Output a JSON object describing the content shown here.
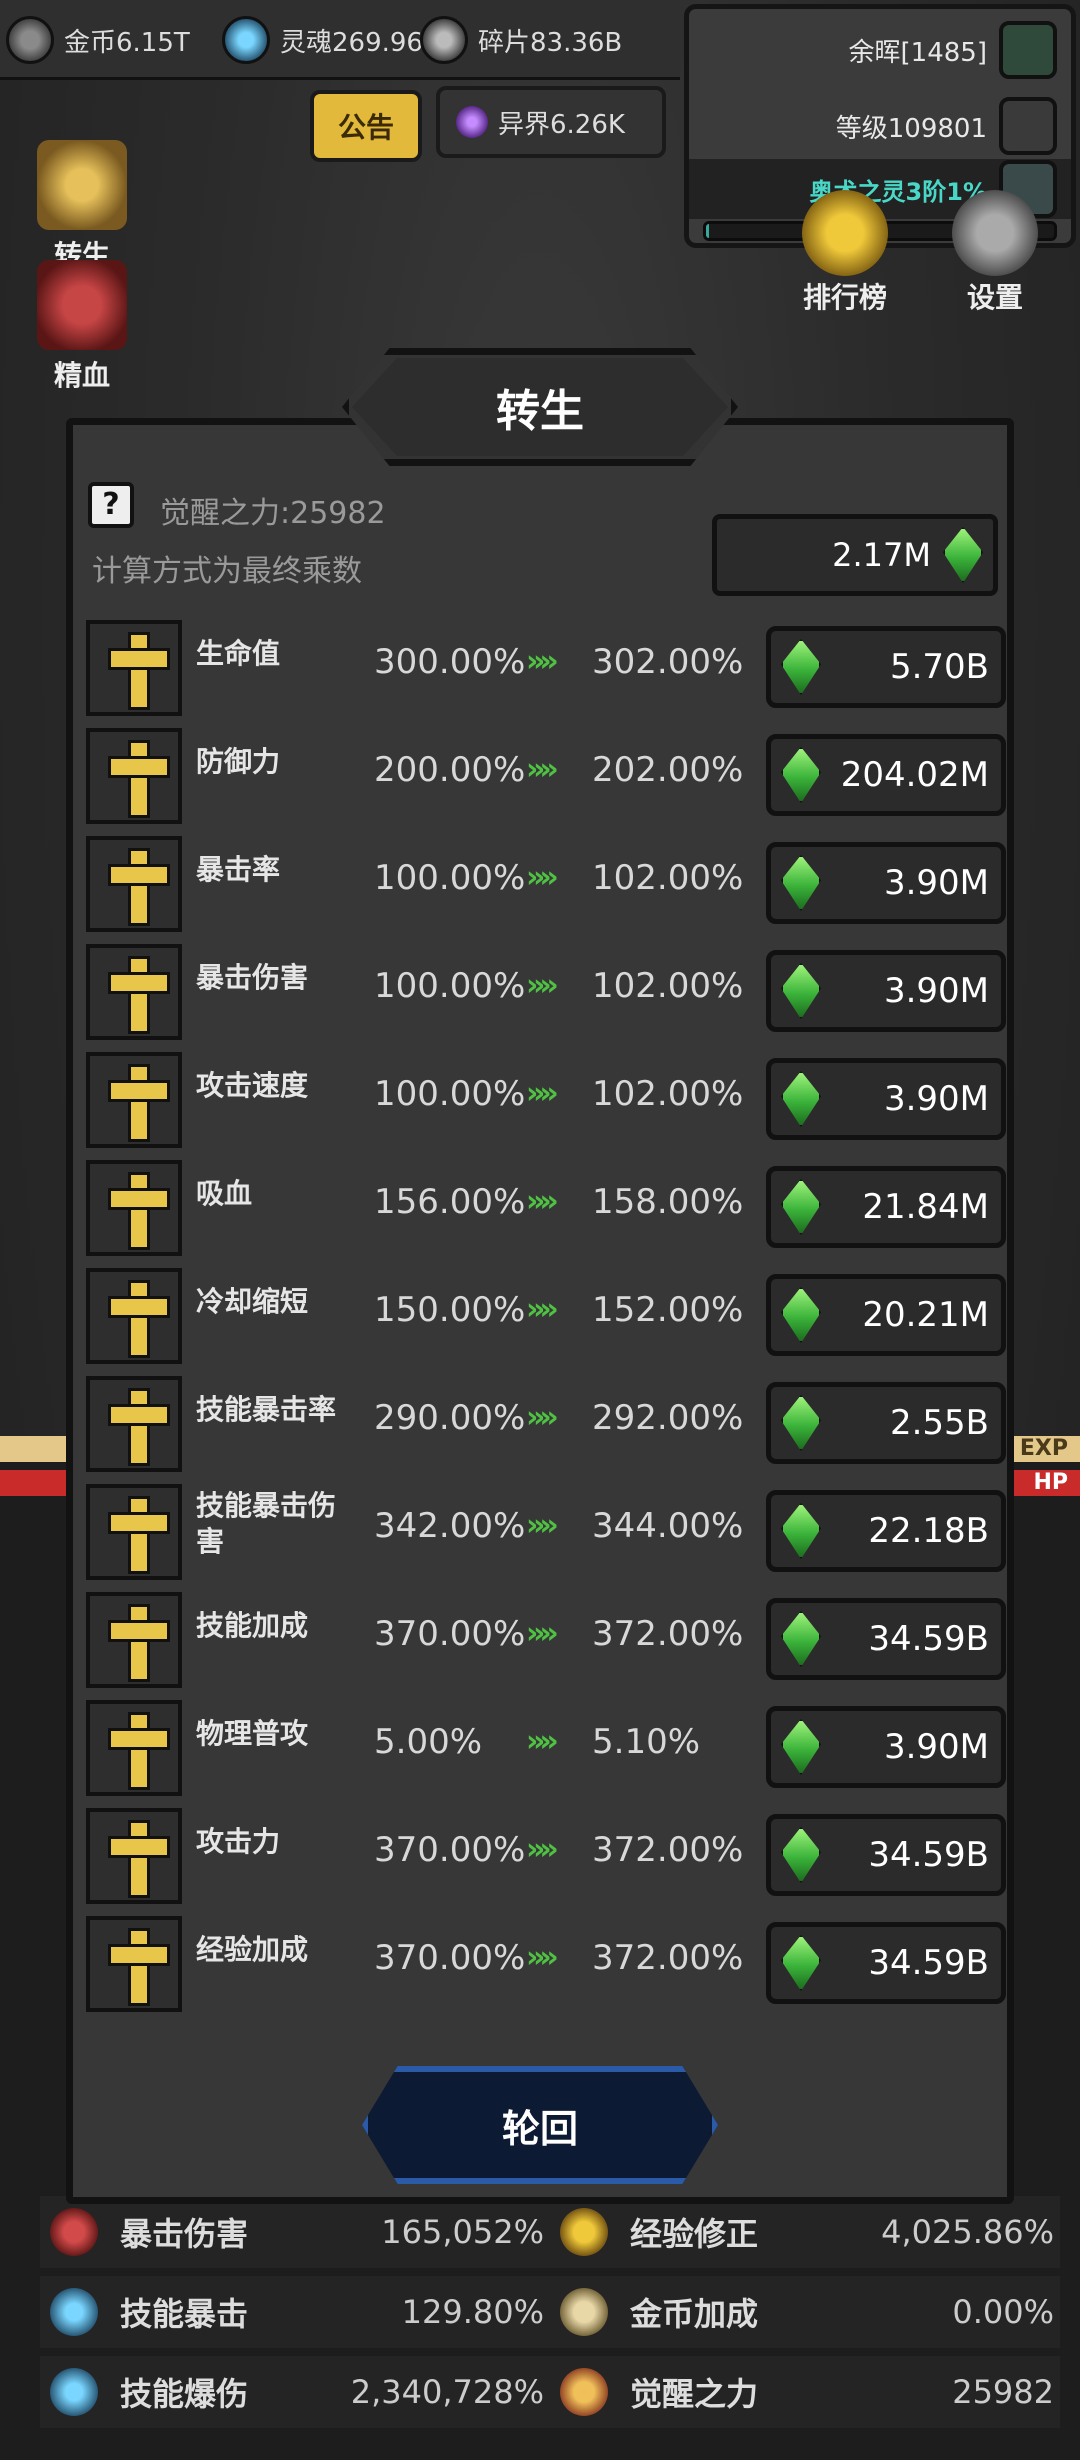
{
  "topbar": {
    "gold": "金币6.15T",
    "soul": "灵魂269.96",
    "fragments": "碎片83.36B",
    "notice": "公告",
    "otherworld": "异界6.26K"
  },
  "status": {
    "afterglow": "余晖[1485]",
    "level": "等级109801",
    "arcane": "奥术之灵3阶1%",
    "arcane_progress_percent": 1
  },
  "side_menu": {
    "rebirth": "转生",
    "blood": "精血",
    "ranking": "排行榜",
    "settings": "设置"
  },
  "bars": {
    "exp": "EXP",
    "hp": "HP"
  },
  "modal": {
    "title": "转生",
    "help": "?",
    "awaken_power": "觉醒之力:25982",
    "calc_note": "计算方式为最终乘数",
    "total_cost": "2.17M",
    "arrows": "»",
    "rebirth_button": "轮回",
    "rows": [
      {
        "name": "生命值",
        "current": "300.00%",
        "next": "302.00%",
        "cost": "5.70B"
      },
      {
        "name": "防御力",
        "current": "200.00%",
        "next": "202.00%",
        "cost": "204.02M"
      },
      {
        "name": "暴击率",
        "current": "100.00%",
        "next": "102.00%",
        "cost": "3.90M"
      },
      {
        "name": "暴击伤害",
        "current": "100.00%",
        "next": "102.00%",
        "cost": "3.90M"
      },
      {
        "name": "攻击速度",
        "current": "100.00%",
        "next": "102.00%",
        "cost": "3.90M"
      },
      {
        "name": "吸血",
        "current": "156.00%",
        "next": "158.00%",
        "cost": "21.84M"
      },
      {
        "name": "冷却缩短",
        "current": "150.00%",
        "next": "152.00%",
        "cost": "20.21M"
      },
      {
        "name": "技能暴击率",
        "current": "290.00%",
        "next": "292.00%",
        "cost": "2.55B"
      },
      {
        "name": "技能暴击伤害",
        "current": "342.00%",
        "next": "344.00%",
        "cost": "22.18B"
      },
      {
        "name": "技能加成",
        "current": "370.00%",
        "next": "372.00%",
        "cost": "34.59B"
      },
      {
        "name": "物理普攻",
        "current": "5.00%",
        "next": "5.10%",
        "cost": "3.90M"
      },
      {
        "name": "攻击力",
        "current": "370.00%",
        "next": "372.00%",
        "cost": "34.59B"
      },
      {
        "name": "经验加成",
        "current": "370.00%",
        "next": "372.00%",
        "cost": "34.59B"
      }
    ]
  },
  "bottom_stats": [
    {
      "label": "暴击伤害",
      "value": "165,052%"
    },
    {
      "label": "经验修正",
      "value": "4,025.86%"
    },
    {
      "label": "技能暴击",
      "value": "129.80%"
    },
    {
      "label": "金币加成",
      "value": "0.00%"
    },
    {
      "label": "技能爆伤",
      "value": "2,340,728%"
    },
    {
      "label": "觉醒之力",
      "value": "25982"
    }
  ]
}
